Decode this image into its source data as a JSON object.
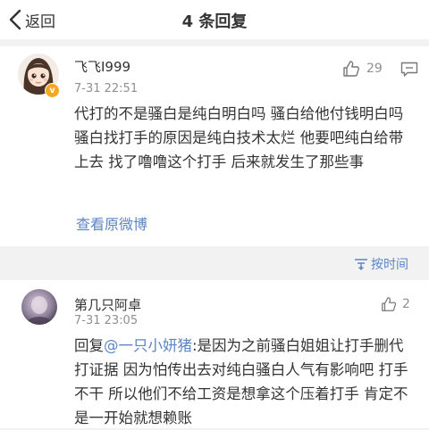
{
  "nav": {
    "back_label": "返回",
    "title": "4 条回复"
  },
  "main_comment": {
    "username": "飞飞I999",
    "timestamp": "7-31 22:51",
    "likes": "29",
    "text": "代打的不是骚白是纯白明白吗 骚白给他付钱明白吗 骚白找打手的原因是纯白技术太烂 他要吧纯白给带上去 找了噜噜这个打手 后来就发生了那些事",
    "view_original": "查看原微博"
  },
  "sort": {
    "label": "按时间"
  },
  "reply": {
    "username": "第几只阿卓",
    "timestamp": "7-31 23:05",
    "likes": "2",
    "prefix": "回复",
    "mention": "@一只小妍猪",
    "text": ":是因为之前骚白姐姐让打手删代打证据 因为怕传出去对纯白骚白人气有影响吧 打手不干 所以他们不给工资是想拿这个压着打手 肯定不是一开始就想赖账"
  },
  "colors": {
    "link": "#5b86c4",
    "verified_badge": "#f5a623",
    "muted": "#8f8f8f",
    "background": "#f2f2f2"
  },
  "icons": {
    "back": "chevron-left-icon",
    "like": "thumbs-up-icon",
    "comment": "comment-icon",
    "sort": "sort-icon",
    "verified": "verified-badge-icon"
  }
}
